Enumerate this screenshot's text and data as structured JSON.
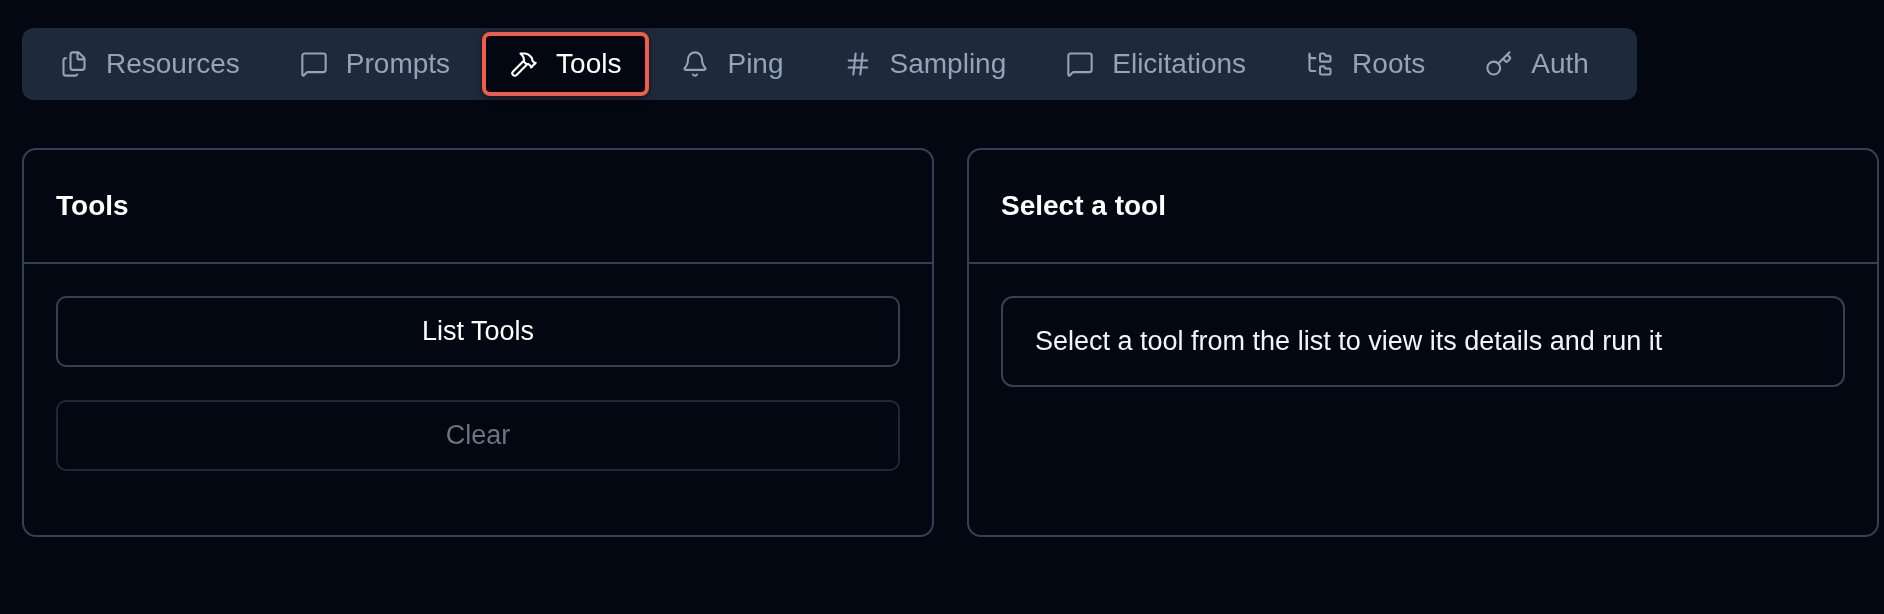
{
  "tabs": [
    {
      "label": "Resources",
      "selected": false
    },
    {
      "label": "Prompts",
      "selected": false
    },
    {
      "label": "Tools",
      "selected": true
    },
    {
      "label": "Ping",
      "selected": false
    },
    {
      "label": "Sampling",
      "selected": false
    },
    {
      "label": "Elicitations",
      "selected": false
    },
    {
      "label": "Roots",
      "selected": false
    },
    {
      "label": "Auth",
      "selected": false
    }
  ],
  "tools_panel": {
    "title": "Tools",
    "buttons": [
      {
        "label": "List Tools",
        "disabled": false
      },
      {
        "label": "Clear",
        "disabled": true
      }
    ]
  },
  "detail_panel": {
    "title": "Select a tool",
    "message": "Select a tool from the list to view its details and run it"
  }
}
